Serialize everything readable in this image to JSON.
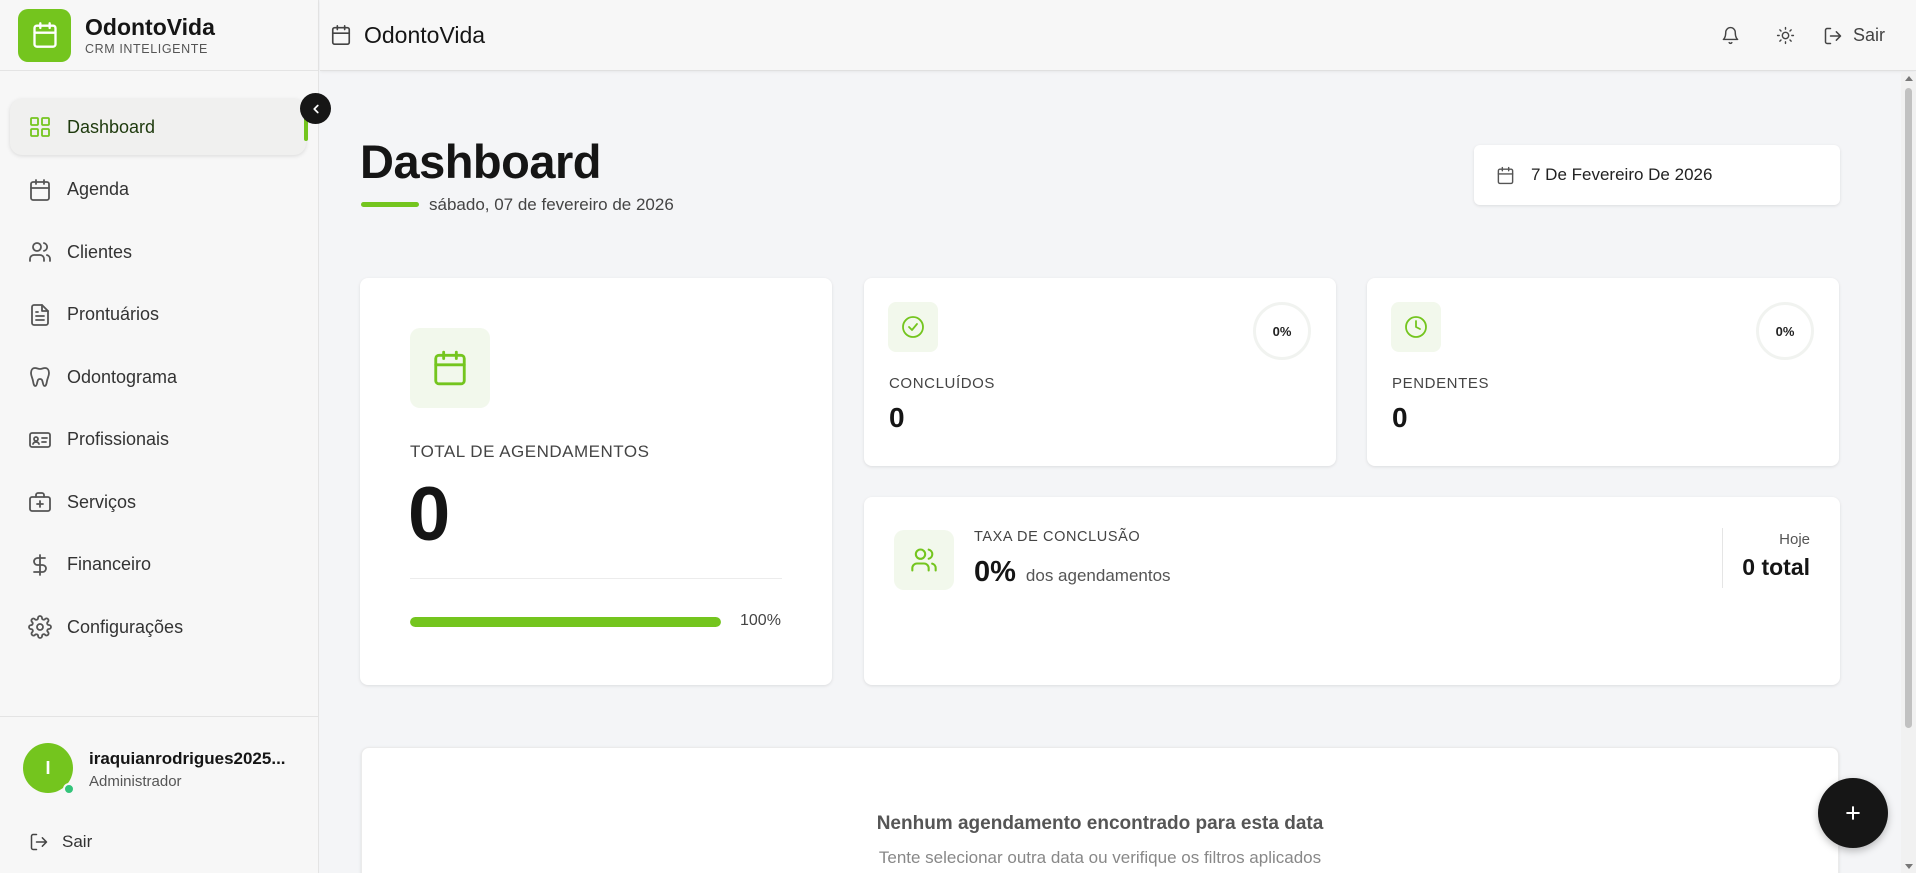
{
  "app": {
    "name": "OdontoVida",
    "tagline": "CRM INTELIGENTE",
    "accent": "#74c51e"
  },
  "header": {
    "title": "OdontoVida",
    "logout": "Sair"
  },
  "sidebar": {
    "items": [
      {
        "label": "Dashboard",
        "icon": "grid-icon",
        "active": true
      },
      {
        "label": "Agenda",
        "icon": "calendar-icon"
      },
      {
        "label": "Clientes",
        "icon": "users-icon"
      },
      {
        "label": "Prontuários",
        "icon": "file-text-icon"
      },
      {
        "label": "Odontograma",
        "icon": "tooth-icon"
      },
      {
        "label": "Profissionais",
        "icon": "id-card-icon"
      },
      {
        "label": "Serviços",
        "icon": "briefcase-medical-icon"
      },
      {
        "label": "Financeiro",
        "icon": "dollar-icon"
      },
      {
        "label": "Configurações",
        "icon": "settings-icon"
      }
    ],
    "user": {
      "initial": "I",
      "name": "iraquianrodrigues2025...",
      "role": "Administrador"
    },
    "logout": "Sair"
  },
  "page": {
    "title": "Dashboard",
    "date_long": "sábado, 07 de fevereiro de 2026"
  },
  "date_picker": {
    "value": "7 De Fevereiro De 2026"
  },
  "stats": {
    "total": {
      "label": "TOTAL DE AGENDAMENTOS",
      "value": "0",
      "progress_label": "100%",
      "progress": 1.0
    },
    "concluidos": {
      "label": "CONCLUÍDOS",
      "value": "0",
      "percent": "0%"
    },
    "pendentes": {
      "label": "PENDENTES",
      "value": "0",
      "percent": "0%"
    },
    "taxa": {
      "label": "TAXA DE CONCLUSÃO",
      "value": "0%",
      "sub": "dos agendamentos",
      "period": "Hoje",
      "total": "0 total"
    }
  },
  "empty": {
    "title": "Nenhum agendamento encontrado para esta data",
    "subtitle": "Tente selecionar outra data ou verifique os filtros aplicados"
  },
  "fab": {
    "icon": "plus-icon"
  }
}
